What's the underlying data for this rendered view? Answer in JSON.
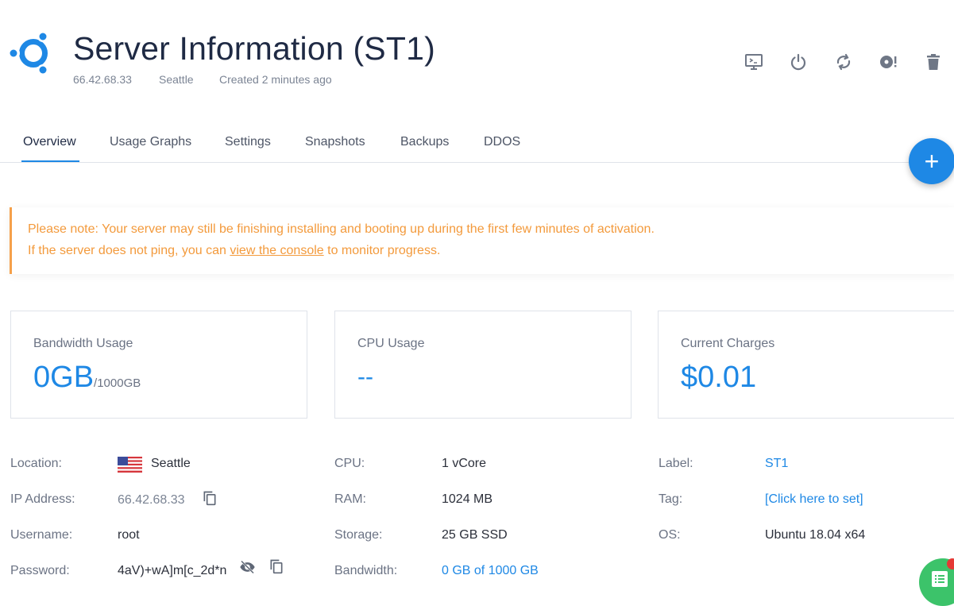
{
  "header": {
    "title": "Server Information (ST1)",
    "ip": "66.42.68.33",
    "location": "Seattle",
    "created": "Created 2 minutes ago",
    "logo_icon": "ubuntu-logo-icon"
  },
  "actions": [
    {
      "name": "console-icon"
    },
    {
      "name": "power-icon"
    },
    {
      "name": "restart-icon"
    },
    {
      "name": "iso-icon"
    },
    {
      "name": "trash-icon"
    }
  ],
  "tabs": [
    {
      "label": "Overview",
      "active": true
    },
    {
      "label": "Usage Graphs"
    },
    {
      "label": "Settings"
    },
    {
      "label": "Snapshots"
    },
    {
      "label": "Backups"
    },
    {
      "label": "DDOS"
    }
  ],
  "fab": {
    "label": "+"
  },
  "notice": {
    "line1": "Please note: Your server may still be finishing installing and booting up during the first few minutes of activation.",
    "line2_prefix": "If the server does not ping, you can ",
    "line2_link": "view the console",
    "line2_suffix": " to monitor progress."
  },
  "cards": {
    "bandwidth": {
      "label": "Bandwidth Usage",
      "value": "0GB",
      "total": "/1000GB"
    },
    "cpu": {
      "label": "CPU Usage",
      "value": "--"
    },
    "charges": {
      "label": "Current Charges",
      "value": "$0.01"
    }
  },
  "details": {
    "location_label": "Location:",
    "location_value": "Seattle",
    "ip_label": "IP Address:",
    "ip_value": "66.42.68.33",
    "username_label": "Username:",
    "username_value": "root",
    "password_label": "Password:",
    "password_value": "4aV)+wA]m[c_2d*n",
    "cpu_label": "CPU:",
    "cpu_value": "1 vCore",
    "ram_label": "RAM:",
    "ram_value": "1024 MB",
    "storage_label": "Storage:",
    "storage_value": "25 GB SSD",
    "bandwidth_label": "Bandwidth:",
    "bandwidth_value": "0 GB of 1000 GB",
    "label_label": "Label:",
    "label_value": "ST1",
    "tag_label": "Tag:",
    "tag_value": "[Click here to set]",
    "os_label": "OS:",
    "os_value": "Ubuntu 18.04 x64"
  },
  "colors": {
    "accent": "#1e88e5",
    "warning": "#f39a3c",
    "chat": "#3cc36a",
    "badge": "#e53935"
  }
}
